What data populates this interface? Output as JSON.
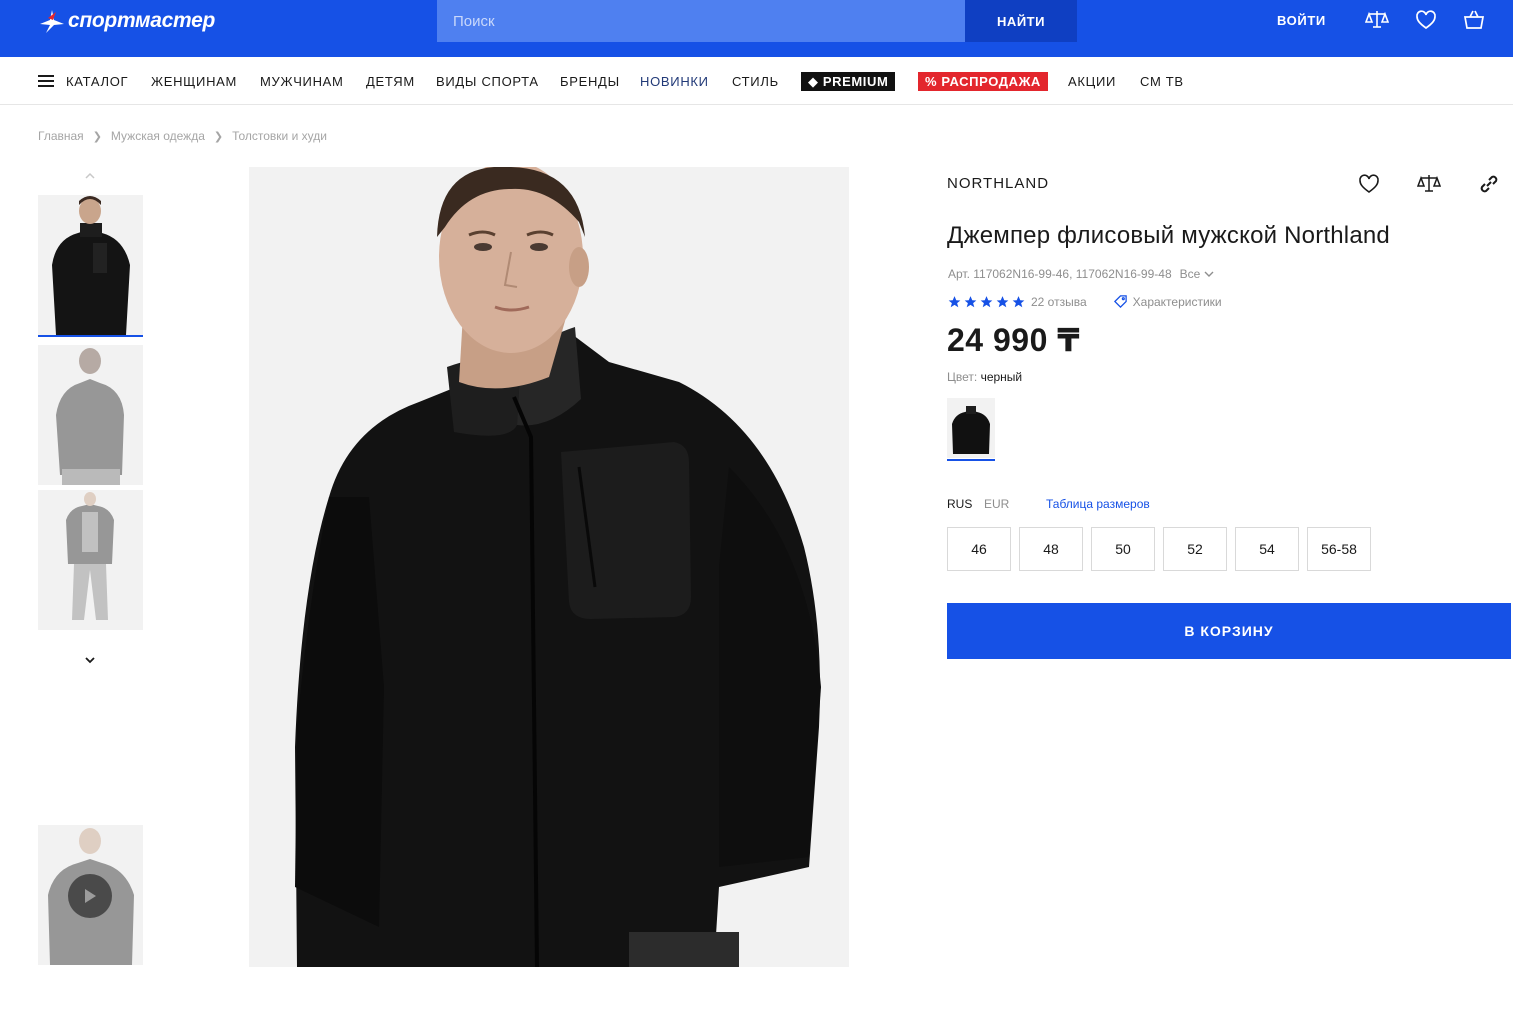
{
  "header": {
    "logo_text": "спортмастер",
    "search_placeholder": "Поиск",
    "search_button": "НАЙТИ",
    "login": "ВОЙТИ",
    "icons": [
      "compare-icon",
      "heart-icon",
      "basket-icon"
    ]
  },
  "nav": {
    "items": [
      "КАТАЛОГ",
      "ЖЕНЩИНАМ",
      "МУЖЧИНАМ",
      "ДЕТЯМ",
      "ВИДЫ СПОРТА",
      "БРЕНДЫ",
      "НОВИНКИ",
      "СТИЛЬ",
      "PREMIUM",
      "% РАСПРОДАЖА",
      "АКЦИИ",
      "СМ ТВ"
    ],
    "sale_color": "#e3262d",
    "premium_color": "#111111"
  },
  "breadcrumb": [
    "Главная",
    "Мужская одежда",
    "Толстовки и худи"
  ],
  "product": {
    "brand": "NORTHLAND",
    "title": "Джемпер флисовый мужской Northland",
    "article": "Арт. 117062N16-99-46, 117062N16-99-48",
    "article_all": "Все",
    "rating": 5,
    "reviews": "22 отзыва",
    "characteristics": "Характеристики",
    "price": "24 990 ₸",
    "color_label": "Цвет:",
    "color_value": "черный",
    "size_systems": [
      "RUS",
      "EUR"
    ],
    "active_size_system": "RUS",
    "size_table": "Таблица размеров",
    "sizes": [
      "46",
      "48",
      "50",
      "52",
      "54",
      "56-58"
    ],
    "cart_button": "В КОРЗИНУ"
  },
  "colors": {
    "brand_blue": "#1651e6",
    "search_bg": "#4f80f0",
    "search_button_bg": "#0f3fc2"
  }
}
